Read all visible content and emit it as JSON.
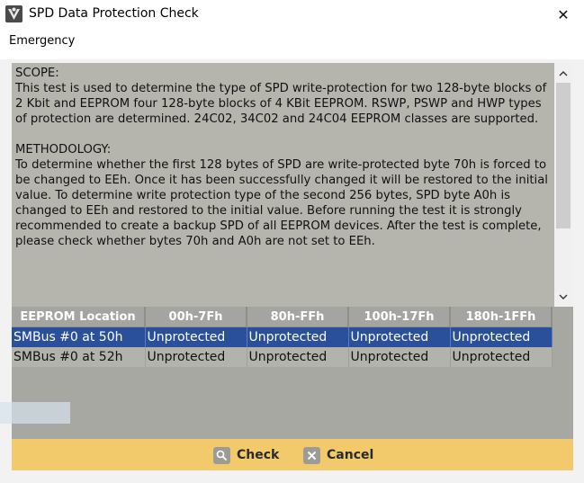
{
  "window": {
    "title": "SPD Data Protection Check",
    "close_glyph": "✕"
  },
  "menu": {
    "items": [
      "Emergency"
    ]
  },
  "description": {
    "text": "SCOPE:\nThis test is used to determine the type of SPD write-protection for two 128-byte blocks of 2 Kbit and EEPROM four 128-byte blocks of 4 KBit EEPROM. RSWP, PSWP and HWP types of protection are determined. 24C02, 34C02 and 24C04 EEPROM classes are supported.\n\nMETHODOLOGY:\nTo determine whether the first 128 bytes of SPD are write-protected byte 70h is forced to be changed to EEh. Once it has been successfully changed it will be restored to the initial value. To determine write protection type of the second 256 bytes, SPD byte A0h is changed to EEh and restored to the initial value. Before running the test it is strongly recommended to create a backup SPD of all EEPROM devices. After the test is complete, please check whether bytes 70h and A0h are not set to EEh."
  },
  "scrollbar": {
    "up_glyph": "^",
    "down_glyph": "v"
  },
  "table": {
    "columns": [
      "EEPROM Location",
      "00h-7Fh",
      "80h-FFh",
      "100h-17Fh",
      "180h-1FFh"
    ],
    "rows": [
      [
        "SMBus #0 at 50h",
        "Unprotected",
        "Unprotected",
        "Unprotected",
        "Unprotected"
      ],
      [
        "SMBus #0 at 52h",
        "Unprotected",
        "Unprotected",
        "Unprotected",
        "Unprotected"
      ]
    ],
    "selected_row": 0
  },
  "buttons": {
    "check_label": "Check",
    "cancel_label": "Cancel"
  },
  "icons": {
    "app": "app-logo-icon",
    "close": "close-icon",
    "check": "magnifier-icon",
    "cancel": "cross-icon"
  },
  "colors": {
    "text_area_bg": "#b5b5ae",
    "grid_bg": "#a8a8a3",
    "selected_row_bg": "#2a4f9b",
    "button_bar_bg": "#f2c96b"
  }
}
